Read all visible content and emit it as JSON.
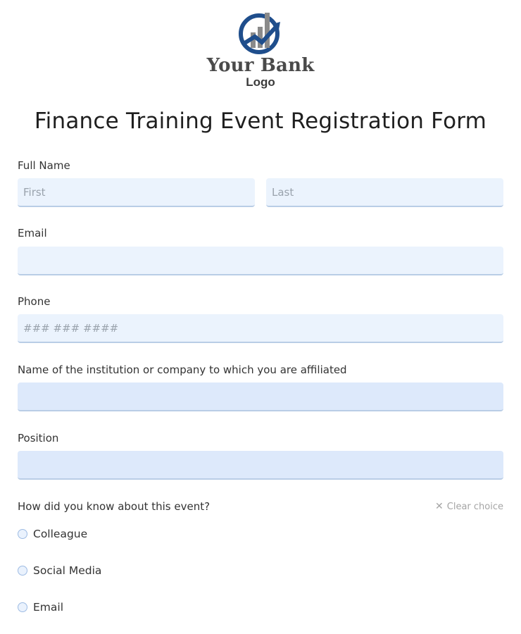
{
  "logo": {
    "name": "Your Bank",
    "subtitle": "Logo"
  },
  "form": {
    "title": "Finance Training Event Registration Form",
    "full_name": {
      "label": "Full Name",
      "first_placeholder": "First",
      "last_placeholder": "Last"
    },
    "email": {
      "label": "Email",
      "placeholder": ""
    },
    "phone": {
      "label": "Phone",
      "placeholder": "### ### ####"
    },
    "institution": {
      "label": "Name of the institution or company to which you are affiliated",
      "placeholder": ""
    },
    "position": {
      "label": "Position",
      "placeholder": ""
    },
    "source": {
      "label": "How did you know about this event?",
      "clear_label": "Clear choice",
      "options": [
        "Colleague",
        "Social Media",
        "Email"
      ]
    }
  },
  "colors": {
    "field_bg": "#ebf3fd",
    "field_bg_selected": "#dde9fb",
    "field_border": "#b9cde6",
    "logo_blue": "#1f4e8c",
    "logo_gray": "#8a8a8a"
  }
}
